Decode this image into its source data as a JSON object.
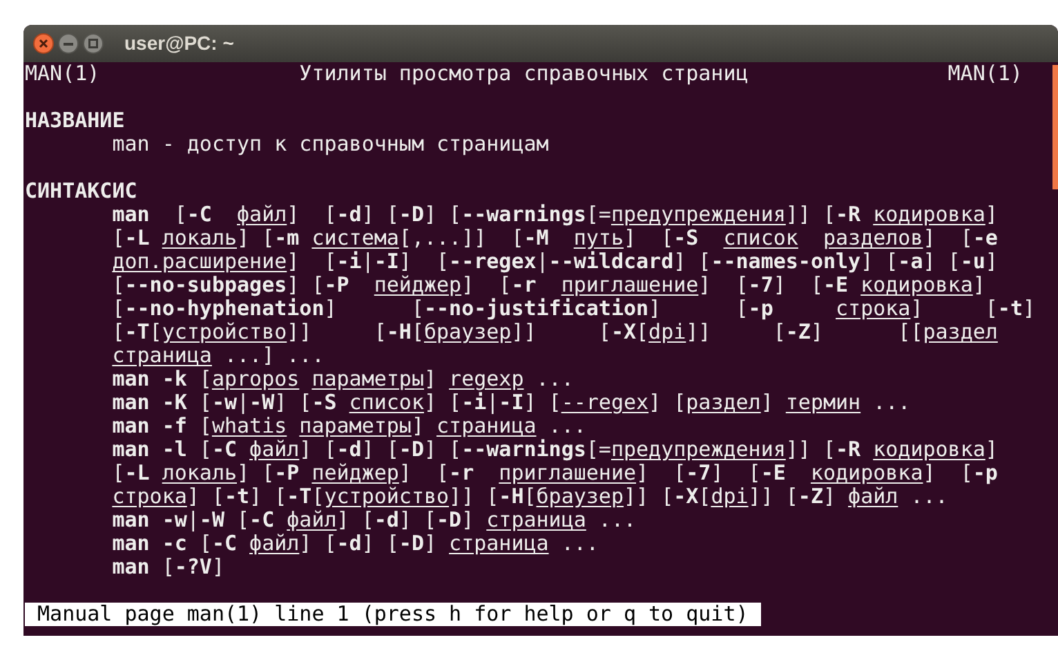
{
  "window": {
    "title": "user@PC: ~"
  },
  "header": {
    "left": "MAN(1)",
    "center": "Утилиты просмотра справочных страниц",
    "right": "MAN(1)"
  },
  "sections": [
    {
      "heading": "НАЗВАНИЕ",
      "lines": [
        [
          {
            "kind": "text",
            "text": "man - доступ к справочным страницам"
          }
        ]
      ]
    },
    {
      "heading": "СИНТАКСИС",
      "lines": [
        [
          {
            "kind": "option",
            "text": "man"
          },
          {
            "kind": "text",
            "text": "  ["
          },
          {
            "kind": "option",
            "text": "-C  "
          },
          {
            "kind": "argument",
            "text": "файл"
          },
          {
            "kind": "text",
            "text": "]  ["
          },
          {
            "kind": "option",
            "text": "-d"
          },
          {
            "kind": "text",
            "text": "] ["
          },
          {
            "kind": "option",
            "text": "-D"
          },
          {
            "kind": "text",
            "text": "] ["
          },
          {
            "kind": "option",
            "text": "--warnings"
          },
          {
            "kind": "text",
            "text": "[="
          },
          {
            "kind": "argument",
            "text": "предупреждения"
          },
          {
            "kind": "text",
            "text": "]] ["
          },
          {
            "kind": "option",
            "text": "-R "
          },
          {
            "kind": "argument",
            "text": "кодировка"
          },
          {
            "kind": "text",
            "text": "]"
          }
        ],
        [
          {
            "kind": "text",
            "text": "["
          },
          {
            "kind": "option",
            "text": "-L "
          },
          {
            "kind": "argument",
            "text": "локаль"
          },
          {
            "kind": "text",
            "text": "] ["
          },
          {
            "kind": "option",
            "text": "-m "
          },
          {
            "kind": "argument",
            "text": "система"
          },
          {
            "kind": "text",
            "text": "[,...]]  ["
          },
          {
            "kind": "option",
            "text": "-M  "
          },
          {
            "kind": "argument",
            "text": "путь"
          },
          {
            "kind": "text",
            "text": "]  ["
          },
          {
            "kind": "option",
            "text": "-S  "
          },
          {
            "kind": "argument",
            "text": "список  "
          },
          {
            "kind": "argument",
            "text": "разделов"
          },
          {
            "kind": "text",
            "text": "]  ["
          },
          {
            "kind": "option",
            "text": "-e"
          }
        ],
        [
          {
            "kind": "argument",
            "text": "доп.расширение"
          },
          {
            "kind": "text",
            "text": "]  ["
          },
          {
            "kind": "option",
            "text": "-i"
          },
          {
            "kind": "text",
            "text": "|"
          },
          {
            "kind": "option",
            "text": "-I"
          },
          {
            "kind": "text",
            "text": "]  ["
          },
          {
            "kind": "option",
            "text": "--regex"
          },
          {
            "kind": "text",
            "text": "|"
          },
          {
            "kind": "option",
            "text": "--wildcard"
          },
          {
            "kind": "text",
            "text": "] ["
          },
          {
            "kind": "option",
            "text": "--names-only"
          },
          {
            "kind": "text",
            "text": "] ["
          },
          {
            "kind": "option",
            "text": "-a"
          },
          {
            "kind": "text",
            "text": "] ["
          },
          {
            "kind": "option",
            "text": "-u"
          },
          {
            "kind": "text",
            "text": "]"
          }
        ],
        [
          {
            "kind": "text",
            "text": "["
          },
          {
            "kind": "option",
            "text": "--no-subpages"
          },
          {
            "kind": "text",
            "text": "] ["
          },
          {
            "kind": "option",
            "text": "-P  "
          },
          {
            "kind": "argument",
            "text": "пейджер"
          },
          {
            "kind": "text",
            "text": "]  ["
          },
          {
            "kind": "option",
            "text": "-r  "
          },
          {
            "kind": "argument",
            "text": "приглашение"
          },
          {
            "kind": "text",
            "text": "]  ["
          },
          {
            "kind": "option",
            "text": "-7"
          },
          {
            "kind": "text",
            "text": "]  ["
          },
          {
            "kind": "option",
            "text": "-E "
          },
          {
            "kind": "argument",
            "text": "кодировка"
          },
          {
            "kind": "text",
            "text": "]"
          }
        ],
        [
          {
            "kind": "text",
            "text": "["
          },
          {
            "kind": "option",
            "text": "--no-hyphenation"
          },
          {
            "kind": "text",
            "text": "]      ["
          },
          {
            "kind": "option",
            "text": "--no-justification"
          },
          {
            "kind": "text",
            "text": "]      ["
          },
          {
            "kind": "option",
            "text": "-p     "
          },
          {
            "kind": "argument",
            "text": "строка"
          },
          {
            "kind": "text",
            "text": "]     ["
          },
          {
            "kind": "option",
            "text": "-t"
          },
          {
            "kind": "text",
            "text": "]"
          }
        ],
        [
          {
            "kind": "text",
            "text": "["
          },
          {
            "kind": "option",
            "text": "-T"
          },
          {
            "kind": "text",
            "text": "["
          },
          {
            "kind": "argument",
            "text": "устройство"
          },
          {
            "kind": "text",
            "text": "]]     ["
          },
          {
            "kind": "option",
            "text": "-H"
          },
          {
            "kind": "text",
            "text": "["
          },
          {
            "kind": "argument",
            "text": "браузер"
          },
          {
            "kind": "text",
            "text": "]]     ["
          },
          {
            "kind": "option",
            "text": "-X"
          },
          {
            "kind": "text",
            "text": "["
          },
          {
            "kind": "argument",
            "text": "dpi"
          },
          {
            "kind": "text",
            "text": "]]     ["
          },
          {
            "kind": "option",
            "text": "-Z"
          },
          {
            "kind": "text",
            "text": "]      [["
          },
          {
            "kind": "argument",
            "text": "раздел"
          }
        ],
        [
          {
            "kind": "argument",
            "text": "страница"
          },
          {
            "kind": "text",
            "text": " ...] ..."
          }
        ],
        [
          {
            "kind": "option",
            "text": "man -k"
          },
          {
            "kind": "text",
            "text": " ["
          },
          {
            "kind": "argument",
            "text": "apropos "
          },
          {
            "kind": "argument",
            "text": "параметры"
          },
          {
            "kind": "text",
            "text": "] "
          },
          {
            "kind": "argument",
            "text": "regexp"
          },
          {
            "kind": "text",
            "text": " ..."
          }
        ],
        [
          {
            "kind": "option",
            "text": "man -K"
          },
          {
            "kind": "text",
            "text": " ["
          },
          {
            "kind": "option",
            "text": "-w"
          },
          {
            "kind": "text",
            "text": "|"
          },
          {
            "kind": "option",
            "text": "-W"
          },
          {
            "kind": "text",
            "text": "] ["
          },
          {
            "kind": "option",
            "text": "-S "
          },
          {
            "kind": "argument",
            "text": "список"
          },
          {
            "kind": "text",
            "text": "] ["
          },
          {
            "kind": "option",
            "text": "-i"
          },
          {
            "kind": "text",
            "text": "|"
          },
          {
            "kind": "option",
            "text": "-I"
          },
          {
            "kind": "text",
            "text": "] ["
          },
          {
            "kind": "argument",
            "text": "--regex"
          },
          {
            "kind": "text",
            "text": "] ["
          },
          {
            "kind": "argument",
            "text": "раздел"
          },
          {
            "kind": "text",
            "text": "] "
          },
          {
            "kind": "argument",
            "text": "термин"
          },
          {
            "kind": "text",
            "text": " ..."
          }
        ],
        [
          {
            "kind": "option",
            "text": "man -f"
          },
          {
            "kind": "text",
            "text": " ["
          },
          {
            "kind": "argument",
            "text": "whatis "
          },
          {
            "kind": "argument",
            "text": "параметры"
          },
          {
            "kind": "text",
            "text": "] "
          },
          {
            "kind": "argument",
            "text": "страница"
          },
          {
            "kind": "text",
            "text": " ..."
          }
        ],
        [
          {
            "kind": "option",
            "text": "man -l"
          },
          {
            "kind": "text",
            "text": " ["
          },
          {
            "kind": "option",
            "text": "-C "
          },
          {
            "kind": "argument",
            "text": "файл"
          },
          {
            "kind": "text",
            "text": "] ["
          },
          {
            "kind": "option",
            "text": "-d"
          },
          {
            "kind": "text",
            "text": "] ["
          },
          {
            "kind": "option",
            "text": "-D"
          },
          {
            "kind": "text",
            "text": "] ["
          },
          {
            "kind": "option",
            "text": "--warnings"
          },
          {
            "kind": "text",
            "text": "[="
          },
          {
            "kind": "argument",
            "text": "предупреждения"
          },
          {
            "kind": "text",
            "text": "]] ["
          },
          {
            "kind": "option",
            "text": "-R "
          },
          {
            "kind": "argument",
            "text": "кодировка"
          },
          {
            "kind": "text",
            "text": "]"
          }
        ],
        [
          {
            "kind": "text",
            "text": "["
          },
          {
            "kind": "option",
            "text": "-L "
          },
          {
            "kind": "argument",
            "text": "локаль"
          },
          {
            "kind": "text",
            "text": "] ["
          },
          {
            "kind": "option",
            "text": "-P "
          },
          {
            "kind": "argument",
            "text": "пейджер"
          },
          {
            "kind": "text",
            "text": "]  ["
          },
          {
            "kind": "option",
            "text": "-r  "
          },
          {
            "kind": "argument",
            "text": "приглашение"
          },
          {
            "kind": "text",
            "text": "]  ["
          },
          {
            "kind": "option",
            "text": "-7"
          },
          {
            "kind": "text",
            "text": "]  ["
          },
          {
            "kind": "option",
            "text": "-E  "
          },
          {
            "kind": "argument",
            "text": "кодировка"
          },
          {
            "kind": "text",
            "text": "]  ["
          },
          {
            "kind": "option",
            "text": "-p"
          }
        ],
        [
          {
            "kind": "argument",
            "text": "строка"
          },
          {
            "kind": "text",
            "text": "] ["
          },
          {
            "kind": "option",
            "text": "-t"
          },
          {
            "kind": "text",
            "text": "] ["
          },
          {
            "kind": "option",
            "text": "-T"
          },
          {
            "kind": "text",
            "text": "["
          },
          {
            "kind": "argument",
            "text": "устройство"
          },
          {
            "kind": "text",
            "text": "]] ["
          },
          {
            "kind": "option",
            "text": "-H"
          },
          {
            "kind": "text",
            "text": "["
          },
          {
            "kind": "argument",
            "text": "браузер"
          },
          {
            "kind": "text",
            "text": "]] ["
          },
          {
            "kind": "option",
            "text": "-X"
          },
          {
            "kind": "text",
            "text": "["
          },
          {
            "kind": "argument",
            "text": "dpi"
          },
          {
            "kind": "text",
            "text": "]] ["
          },
          {
            "kind": "option",
            "text": "-Z"
          },
          {
            "kind": "text",
            "text": "] "
          },
          {
            "kind": "argument",
            "text": "файл"
          },
          {
            "kind": "text",
            "text": " ..."
          }
        ],
        [
          {
            "kind": "option",
            "text": "man -w"
          },
          {
            "kind": "text",
            "text": "|"
          },
          {
            "kind": "option",
            "text": "-W"
          },
          {
            "kind": "text",
            "text": " ["
          },
          {
            "kind": "option",
            "text": "-C "
          },
          {
            "kind": "argument",
            "text": "файл"
          },
          {
            "kind": "text",
            "text": "] ["
          },
          {
            "kind": "option",
            "text": "-d"
          },
          {
            "kind": "text",
            "text": "] ["
          },
          {
            "kind": "option",
            "text": "-D"
          },
          {
            "kind": "text",
            "text": "] "
          },
          {
            "kind": "argument",
            "text": "страница"
          },
          {
            "kind": "text",
            "text": " ..."
          }
        ],
        [
          {
            "kind": "option",
            "text": "man -c"
          },
          {
            "kind": "text",
            "text": " ["
          },
          {
            "kind": "option",
            "text": "-C "
          },
          {
            "kind": "argument",
            "text": "файл"
          },
          {
            "kind": "text",
            "text": "] ["
          },
          {
            "kind": "option",
            "text": "-d"
          },
          {
            "kind": "text",
            "text": "] ["
          },
          {
            "kind": "option",
            "text": "-D"
          },
          {
            "kind": "text",
            "text": "] "
          },
          {
            "kind": "argument",
            "text": "страница"
          },
          {
            "kind": "text",
            "text": " ..."
          }
        ],
        [
          {
            "kind": "option",
            "text": "man"
          },
          {
            "kind": "text",
            "text": " ["
          },
          {
            "kind": "option",
            "text": "-?V"
          },
          {
            "kind": "text",
            "text": "]"
          }
        ]
      ]
    }
  ],
  "status_bar": "Manual page man(1) line 1 (press h for help or q to quit)"
}
